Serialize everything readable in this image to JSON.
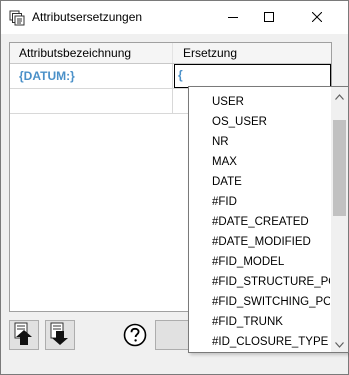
{
  "window": {
    "title": "Attributsersetzungen",
    "icon": "copy-stack-icon",
    "controls": [
      "minimize-icon",
      "maximize-icon",
      "close-icon"
    ]
  },
  "grid": {
    "columns": [
      "Attributsbezeichnung",
      "Ersetzung"
    ],
    "rows": [
      {
        "attribute": "{DATUM:}",
        "replacement": "{"
      },
      {
        "attribute": "",
        "replacement": ""
      }
    ]
  },
  "dropdown": {
    "items": [
      "USER",
      "OS_USER",
      "NR",
      "MAX",
      "DATE",
      "#FID",
      "#DATE_CREATED",
      "#DATE_MODIFIED",
      "#FID_MODEL",
      "#FID_STRUCTURE_POI",
      "#FID_SWITCHING_POI",
      "#FID_TRUNK",
      "#ID_CLOSURE_TYPE"
    ]
  },
  "toolbar": {
    "icons": [
      "move-up-icon",
      "move-down-icon",
      "help-icon"
    ]
  },
  "colors": {
    "value_text": "#4a90c8",
    "window_bg": "#f0f0f0",
    "scroll_thumb": "#c1c1c1"
  }
}
